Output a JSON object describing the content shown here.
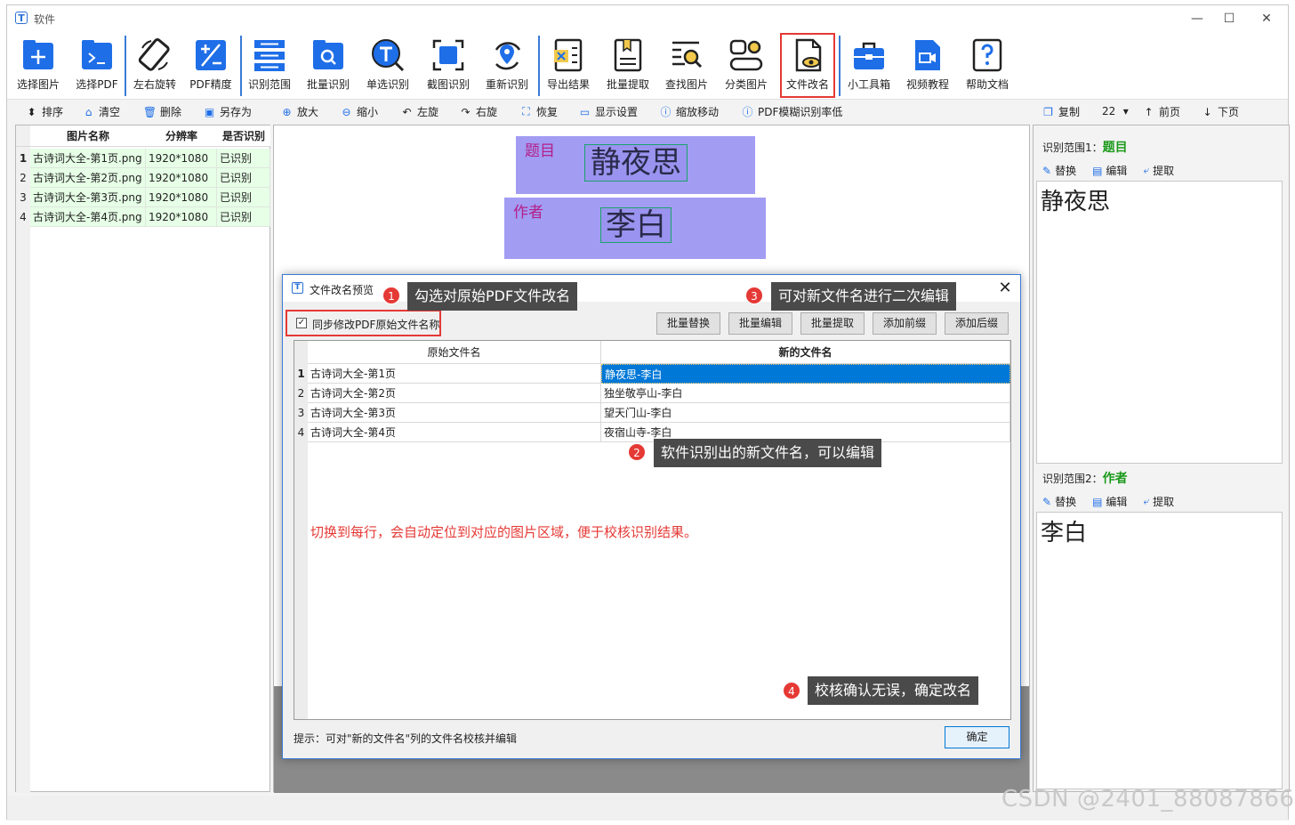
{
  "window": {
    "title": "软件"
  },
  "toolbar": {
    "buttons": [
      {
        "label": "选择图片",
        "icon": "add-image-icon"
      },
      {
        "label": "选择PDF",
        "icon": "pdf-folder-icon"
      },
      {
        "label": "左右旋转",
        "icon": "rotate-icon"
      },
      {
        "label": "PDF精度",
        "icon": "precision-icon"
      },
      {
        "label": "识别范围",
        "icon": "range-icon"
      },
      {
        "label": "批量识别",
        "icon": "batch-search-icon"
      },
      {
        "label": "单选识别",
        "icon": "text-select-icon"
      },
      {
        "label": "截图识别",
        "icon": "screenshot-icon"
      },
      {
        "label": "重新识别",
        "icon": "re-recognize-icon"
      },
      {
        "label": "导出结果",
        "icon": "export-icon"
      },
      {
        "label": "批量提取",
        "icon": "extract-icon"
      },
      {
        "label": "查找图片",
        "icon": "find-image-icon"
      },
      {
        "label": "分类图片",
        "icon": "classify-icon"
      },
      {
        "label": "文件改名",
        "icon": "rename-file-icon"
      },
      {
        "label": "小工具箱",
        "icon": "toolbox-icon"
      },
      {
        "label": "视频教程",
        "icon": "video-icon"
      },
      {
        "label": "帮助文档",
        "icon": "help-icon"
      }
    ]
  },
  "subbar": {
    "items": [
      "排序",
      "清空",
      "删除",
      "另存为",
      "放大",
      "缩小",
      "左旋",
      "右旋",
      "恢复",
      "显示设置",
      "缩放移动",
      "PDF模糊识别率低"
    ],
    "right": {
      "copy": "复制",
      "page": "22",
      "prev": "前页",
      "next": "下页"
    }
  },
  "file_table": {
    "headers": [
      "图片名称",
      "分辨率",
      "是否识别"
    ],
    "rows": [
      {
        "n": "1",
        "name": "古诗词大全-第1页.png",
        "res": "1920*1080",
        "status": "已识别"
      },
      {
        "n": "2",
        "name": "古诗词大全-第2页.png",
        "res": "1920*1080",
        "status": "已识别"
      },
      {
        "n": "3",
        "name": "古诗词大全-第3页.png",
        "res": "1920*1080",
        "status": "已识别"
      },
      {
        "n": "4",
        "name": "古诗词大全-第4页.png",
        "res": "1920*1080",
        "status": "已识别"
      }
    ]
  },
  "canvas": {
    "region1": {
      "label": "题目",
      "text": "静夜思"
    },
    "region2": {
      "label": "作者",
      "text": "李白"
    }
  },
  "right_panel": {
    "sec1": {
      "title": "识别范围1：",
      "name": "题目",
      "text": "静夜思"
    },
    "sec2": {
      "title": "识别范围2：",
      "name": "作者",
      "text": "李白"
    },
    "tools": {
      "replace": "替换",
      "edit": "编辑",
      "extract": "提取"
    }
  },
  "dialog": {
    "title": "文件改名预览",
    "checkbox_label": "同步修改PDF原始文件名称",
    "buttons": [
      "批量替换",
      "批量编辑",
      "批量提取",
      "添加前缀",
      "添加后缀"
    ],
    "headers": [
      "原始文件名",
      "新的文件名"
    ],
    "rows": [
      {
        "n": "1",
        "orig": "古诗词大全-第1页",
        "new": "静夜思-李白"
      },
      {
        "n": "2",
        "orig": "古诗词大全-第2页",
        "new": "独坐敬亭山-李白"
      },
      {
        "n": "3",
        "orig": "古诗词大全-第3页",
        "new": "望天门山-李白"
      },
      {
        "n": "4",
        "orig": "古诗词大全-第4页",
        "new": "夜宿山寺-李白"
      }
    ],
    "note": "切换到每行，会自动定位到对应的图片区域，便于校核识别结果。",
    "hint": "提示：可对\"新的文件名\"列的文件名校核并编辑",
    "ok": "确定"
  },
  "callouts": [
    {
      "num": "1",
      "text": "勾选对原始PDF文件改名"
    },
    {
      "num": "2",
      "text": "软件识别出的新文件名，可以编辑"
    },
    {
      "num": "3",
      "text": "可对新文件名进行二次编辑"
    },
    {
      "num": "4",
      "text": "校核确认无误，确定改名"
    }
  ],
  "watermark": "CSDN @2401_88087866",
  "colors": {
    "accent": "#2b6fd6",
    "highlight": "#e53935",
    "region": "#a29cf3",
    "recognized": "#e6ffe6",
    "selected_row": "#0078d7"
  }
}
